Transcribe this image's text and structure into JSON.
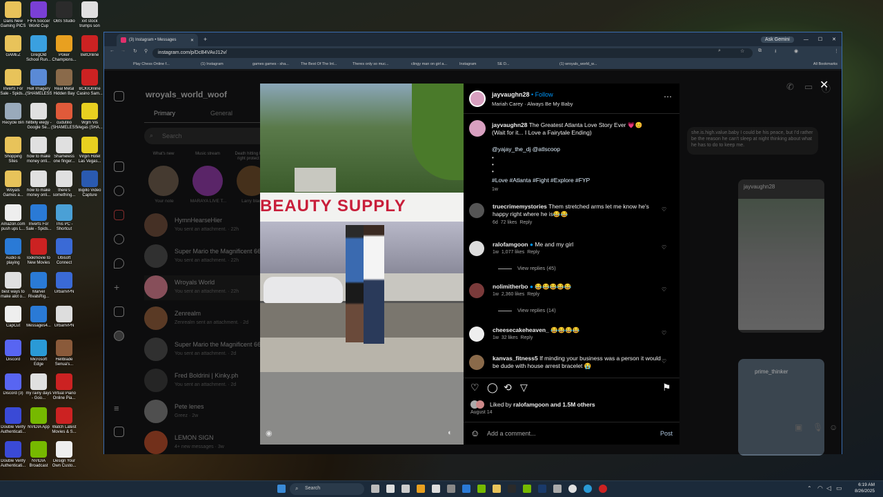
{
  "desktop": {
    "icons": [
      {
        "label": "Dans New Gaming PICS",
        "color": "#e8c35a",
        "col": 0,
        "row": 0
      },
      {
        "label": "FIFA Soccer World Cup",
        "color": "#7a3fd6",
        "col": 1,
        "row": 0
      },
      {
        "label": "OBS Studio",
        "color": "#2b2b2b",
        "col": 2,
        "row": 0
      },
      {
        "label": "xxt stock trumps son",
        "color": "#e0e0e0",
        "col": 3,
        "row": 0
      },
      {
        "label": "GAMEZ",
        "color": "#e8c35a",
        "col": 0,
        "row": 1
      },
      {
        "label": "GregOld School Run...",
        "color": "#3aa0e0",
        "col": 1,
        "row": 1
      },
      {
        "label": "Poker Champions...",
        "color": "#e8a020",
        "col": 2,
        "row": 1
      },
      {
        "label": "BetOnline",
        "color": "#c22",
        "col": 3,
        "row": 1
      },
      {
        "label": "Inverts For Sale - Spids...",
        "color": "#e8c35a",
        "col": 0,
        "row": 2
      },
      {
        "label": "Hell Imagery (SHAMELESS)",
        "color": "#5a8ad6",
        "col": 1,
        "row": 2
      },
      {
        "label": "Real Metal Hidden Bay",
        "color": "#8a6a4a",
        "col": 2,
        "row": 2
      },
      {
        "label": "BCKIOnline Casino Sam...",
        "color": "#c22",
        "col": 3,
        "row": 2
      },
      {
        "label": "Recycle Bin",
        "color": "#9ab",
        "col": 0,
        "row": 3
      },
      {
        "label": "hillbilly elegy - Google Se...",
        "color": "#e0e0e0",
        "col": 1,
        "row": 3
      },
      {
        "label": "cudutilio (SHAMELESS)",
        "color": "#e05a3a",
        "col": 2,
        "row": 3
      },
      {
        "label": "Wgm Vis Vegas (SHA...",
        "color": "#e8d020",
        "col": 3,
        "row": 3
      },
      {
        "label": "Shopping Sites",
        "color": "#e8c35a",
        "col": 0,
        "row": 4
      },
      {
        "label": "how to make money onli...",
        "color": "#e0e0e0",
        "col": 1,
        "row": 4
      },
      {
        "label": "Shameless one finger...",
        "color": "#e0e0e0",
        "col": 2,
        "row": 4
      },
      {
        "label": "Virgin Hotel Las Vegas...",
        "color": "#e8d020",
        "col": 3,
        "row": 4
      },
      {
        "label": "Woyals Games a...",
        "color": "#e8c35a",
        "col": 0,
        "row": 5
      },
      {
        "label": "how to make money onli...",
        "color": "#e0e0e0",
        "col": 1,
        "row": 5
      },
      {
        "label": "there's something...",
        "color": "#e0e0e0",
        "col": 2,
        "row": 5
      },
      {
        "label": "Bigillo Video Capture",
        "color": "#2a5ab0",
        "col": 3,
        "row": 5
      },
      {
        "label": "Amazon.com push ups L...",
        "color": "#eee",
        "col": 0,
        "row": 6
      },
      {
        "label": "Inverts For Sale - Spids...",
        "color": "#2a7ad6",
        "col": 1,
        "row": 6
      },
      {
        "label": "This PC - Shortcut",
        "color": "#4aa0d6",
        "col": 2,
        "row": 6
      },
      {
        "label": "Audio is playing",
        "color": "#2a7ad6",
        "col": 0,
        "row": 7
      },
      {
        "label": "lookmovie to New Movies",
        "color": "#c22",
        "col": 1,
        "row": 7
      },
      {
        "label": "Ubisoft Connect",
        "color": "#3a6ad6",
        "col": 2,
        "row": 7
      },
      {
        "label": "best ways to make alot o...",
        "color": "#e0e0e0",
        "col": 0,
        "row": 8
      },
      {
        "label": "Marvel RivalsRig...",
        "color": "#2a7ad6",
        "col": 1,
        "row": 8
      },
      {
        "label": "UrbanVPN",
        "color": "#3a6ad6",
        "col": 2,
        "row": 8
      },
      {
        "label": "CapCut",
        "color": "#eee",
        "col": 0,
        "row": 9
      },
      {
        "label": "Messages4...",
        "color": "#2a7ad6",
        "col": 1,
        "row": 9
      },
      {
        "label": "UrbanVPN",
        "color": "#ddd",
        "col": 2,
        "row": 9
      },
      {
        "label": "Discord",
        "color": "#5865f2",
        "col": 0,
        "row": 10
      },
      {
        "label": "Microsoft Edge",
        "color": "#2a9ad6",
        "col": 1,
        "row": 10
      },
      {
        "label": "Hellblade Senua's...",
        "color": "#8a5a3a",
        "col": 2,
        "row": 10
      },
      {
        "label": "Discord (3)",
        "color": "#5865f2",
        "col": 0,
        "row": 11
      },
      {
        "label": "my rainy days - Goo...",
        "color": "#e0e0e0",
        "col": 1,
        "row": 11
      },
      {
        "label": "Virtual Piano Online Pia...",
        "color": "#c22",
        "col": 2,
        "row": 11
      },
      {
        "label": "Double Verify Authenticati...",
        "color": "#3a4ad6",
        "col": 0,
        "row": 12
      },
      {
        "label": "NVIDIA App",
        "color": "#76b900",
        "col": 1,
        "row": 12
      },
      {
        "label": "Watch Latest Movies & S...",
        "color": "#c22",
        "col": 2,
        "row": 12
      },
      {
        "label": "Double Verify Authenticati...",
        "color": "#3a4ad6",
        "col": 0,
        "row": 13
      },
      {
        "label": "NVIDIA Broadcast",
        "color": "#76b900",
        "col": 1,
        "row": 13
      },
      {
        "label": "Design Your Own Custo...",
        "color": "#eee",
        "col": 2,
        "row": 13
      }
    ]
  },
  "browser": {
    "tab_title": "(3) Instagram • Messages",
    "url": "instagram.com/p/DcB4VAvJ12v/",
    "ask_gemini": "Ask Gemini",
    "all_bookmarks": "All Bookmarks",
    "bookmarks": [
      "Play Chess Online f...",
      "(1) Instagram",
      "games games - sha...",
      "The Best Of The Int...",
      "Theres only so muc...",
      "clingy man on girl a...",
      "Instagram",
      "SE D...",
      "(1) wroyals_world_w..."
    ]
  },
  "instagram": {
    "account": "wroyals_world_woof",
    "tabs": {
      "primary": "Primary",
      "general": "General"
    },
    "search_placeholder": "Search",
    "notes": [
      {
        "note": "What's new",
        "name": "Your note"
      },
      {
        "note": "Music stream",
        "name": "MARAYA LIVE T..."
      },
      {
        "note": "Death hitting left & right protect me",
        "name": "Larry black"
      }
    ],
    "threads": [
      {
        "name": "HymnHearseHier",
        "sub": "You sent an attachment. · 22h",
        "color": "#6a4a3a"
      },
      {
        "name": "Super Mario the Magnificent 66",
        "sub": "You sent an attachment. · 22h",
        "color": "#4a4a4a"
      },
      {
        "name": "Wroyals World",
        "sub": "You sent an attachment. · 22h",
        "color": "#d07a8a"
      },
      {
        "name": "Zenrealm",
        "sub": "Zenrealm sent an attachment. · 2d",
        "color": "#8a5a3a"
      },
      {
        "name": "Super Mario the Magnificent 66",
        "sub": "You sent an attachment. · 2d",
        "color": "#4a4a4a"
      },
      {
        "name": "Fred Boldrini | Kinky.ph",
        "sub": "You sent an attachment. · 2d",
        "color": "#3a3a3a"
      },
      {
        "name": "Pete lenes",
        "sub": "Greez · 2w",
        "color": "#7a7a7a"
      },
      {
        "name": "LEMON SIGN",
        "sub": "4+ new messages · 3w",
        "color": "#b04a2a"
      }
    ],
    "chat_preview": "she.is.high.value.baby I could be his peace, but I'd rather be the reason he can't sleep at night thinking about what he has to do to keep me.",
    "shared_post_user": "jayvaughn28",
    "shared_user2": "prime_thinker"
  },
  "post": {
    "username": "jayvaughn28",
    "follow": "Follow",
    "music": "Mariah Carey · Always Be My Baby",
    "sign_text": "BEAUTY SUPPLY",
    "caption_user": "jayvaughn28",
    "caption": "The Greatest Atlanta Love Story Ever 💗😊 (Wait for it... I Love a Fairytale Ending)",
    "mentions": "@yajay_the_dj @atlscoop",
    "hashtags": "#Love #Atlanta #Fight #Explore #FYP",
    "caption_time": "1w",
    "comments": [
      {
        "user": "truecrimemystories",
        "text": "Them stretched arms let me know he's happy right where he is😂😂",
        "time": "6d",
        "likes": "72 likes",
        "reply": "Reply",
        "color": "#555"
      },
      {
        "user": "ralofamgoon",
        "verified": true,
        "text": "Me and my girl",
        "time": "1w",
        "likes": "1,077 likes",
        "reply": "Reply",
        "replies": "View replies (45)",
        "color": "#ddd"
      },
      {
        "user": "nolimitherbo",
        "verified": true,
        "text": "😂😂😂😂😂",
        "time": "1w",
        "likes": "2,360 likes",
        "reply": "Reply",
        "replies": "View replies (14)",
        "color": "#7a3a3a"
      },
      {
        "user": "cheesecakeheaven_",
        "text": "😂😂😂😂",
        "time": "1w",
        "likes": "32 likes",
        "reply": "Reply",
        "color": "#eee"
      },
      {
        "user": "kanvas_fitness5",
        "text": "If minding your business was a person it would be dude with house arrest bracelet 😭",
        "color": "#8a6a4a"
      }
    ],
    "liked_by_prefix": "Liked by",
    "liked_by_user": "ralofamgoon",
    "liked_by_suffix": "and 1.5M others",
    "date": "August 14",
    "comment_placeholder": "Add a comment...",
    "post_button": "Post"
  },
  "taskbar": {
    "search": "Search",
    "time": "6:19 AM",
    "date": "8/26/2025"
  }
}
